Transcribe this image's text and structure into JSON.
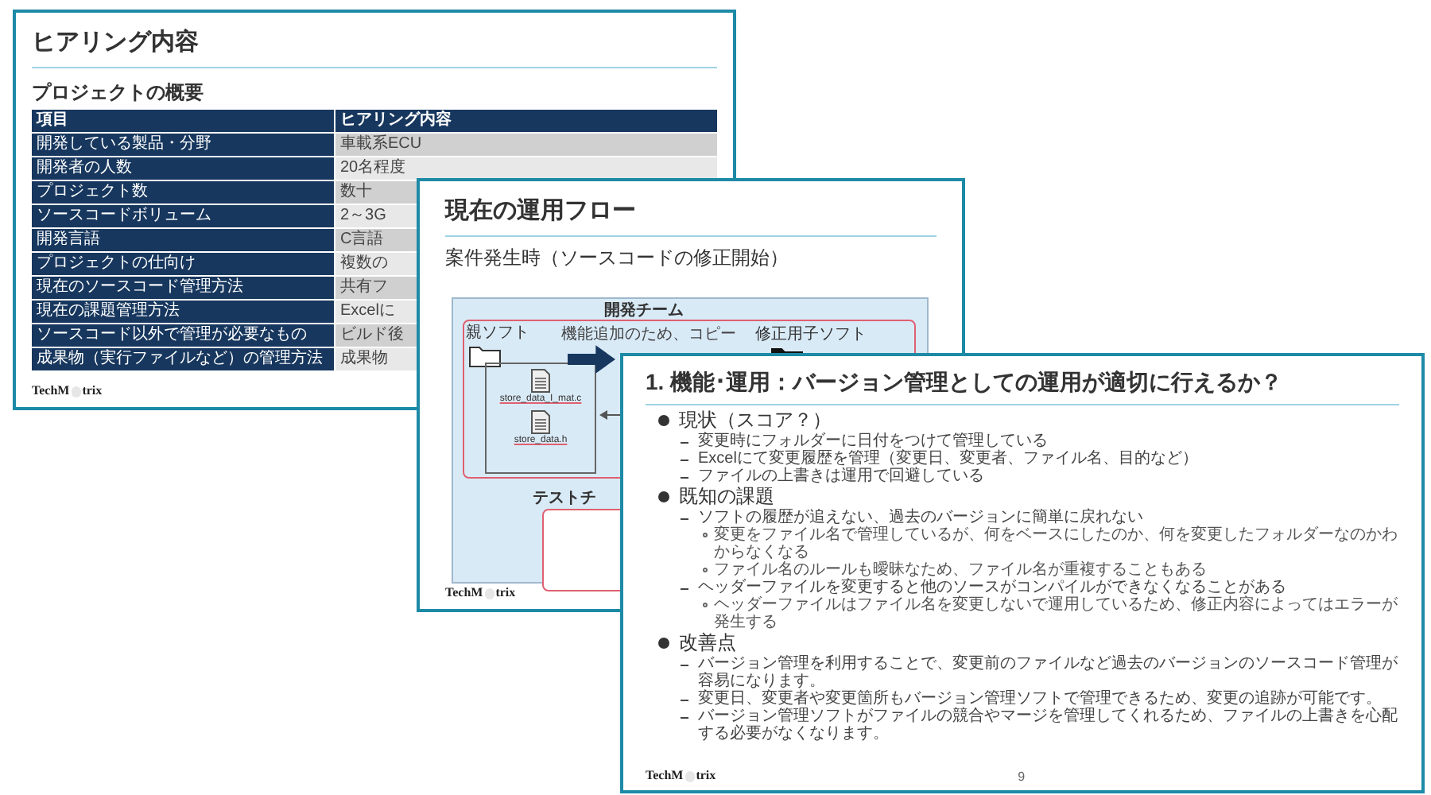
{
  "slides": [
    {
      "kind": "table",
      "title": "ヒアリング内容",
      "subtitle": "プロジェクトの概要",
      "table": {
        "columns": [
          "項目",
          "ヒアリング内容"
        ],
        "rows": [
          [
            "開発している製品・分野",
            "車載系ECU"
          ],
          [
            "開発者の人数",
            "20名程度"
          ],
          [
            "プロジェクト数",
            "数十"
          ],
          [
            "ソースコードボリューム",
            "2～3G"
          ],
          [
            "開発言語",
            "C言語"
          ],
          [
            "プロジェクトの仕向け",
            "複数の"
          ],
          [
            "現在のソースコード管理方法",
            "共有フ"
          ],
          [
            "現在の課題管理方法",
            "Excelに"
          ],
          [
            "ソースコード以外で管理が必要なもの",
            "ビルド後"
          ],
          [
            "成果物（実行ファイルなど）の管理方法",
            "成果物"
          ]
        ]
      },
      "logo": [
        "TechM",
        "trix"
      ]
    },
    {
      "kind": "flow",
      "title": "現在の運用フロー",
      "subtitle": "案件発生時（ソースコードの修正開始）",
      "diagram": {
        "team_label": "開発チーム",
        "parent_label": "親ソフト",
        "files": [
          "store_data_I_mat.c",
          "store_data.h"
        ],
        "copy_label": "機能追加のため、コピー",
        "child_label": "修正用子ソフト",
        "test_label": "テストチ"
      },
      "logo": [
        "TechM",
        "trix"
      ]
    },
    {
      "kind": "bullets",
      "title": "1. 機能･運用：バージョン管理としての運用が適切に行えるか？",
      "sections": [
        {
          "heading": "現状（スコア？）",
          "items": [
            {
              "text": "変更時にフォルダーに日付をつけて管理している"
            },
            {
              "text": "Excelにて変更履歴を管理（変更日、変更者、ファイル名、目的など）"
            },
            {
              "text": "ファイルの上書きは運用で回避している"
            }
          ]
        },
        {
          "heading": "既知の課題",
          "items": [
            {
              "text": "ソフトの履歴が追えない、過去のバージョンに簡単に戻れない",
              "children": [
                {
                  "text": "変更をファイル名で管理しているが、何をベースにしたのか、何を変更したフォルダーなのかわからなくなる"
                },
                {
                  "text": "ファイル名のルールも曖昧なため、ファイル名が重複することもある"
                }
              ]
            },
            {
              "text": "ヘッダーファイルを変更すると他のソースがコンパイルができなくなることがある",
              "children": [
                {
                  "text": "ヘッダーファイルはファイル名を変更しないで運用しているため、修正内容によってはエラーが発生する"
                }
              ]
            }
          ]
        },
        {
          "heading": "改善点",
          "items": [
            {
              "text": "バージョン管理を利用することで、変更前のファイルなど過去のバージョンのソースコード管理が容易になります。"
            },
            {
              "text": "変更日、変更者や変更箇所もバージョン管理ソフトで管理できるため、変更の追跡が可能です。"
            },
            {
              "text": "バージョン管理ソフトがファイルの競合やマージを管理してくれるため、ファイルの上書きを心配する必要がなくなります。"
            }
          ]
        }
      ],
      "logo": [
        "TechM",
        "trix"
      ],
      "page_number": "9"
    }
  ]
}
